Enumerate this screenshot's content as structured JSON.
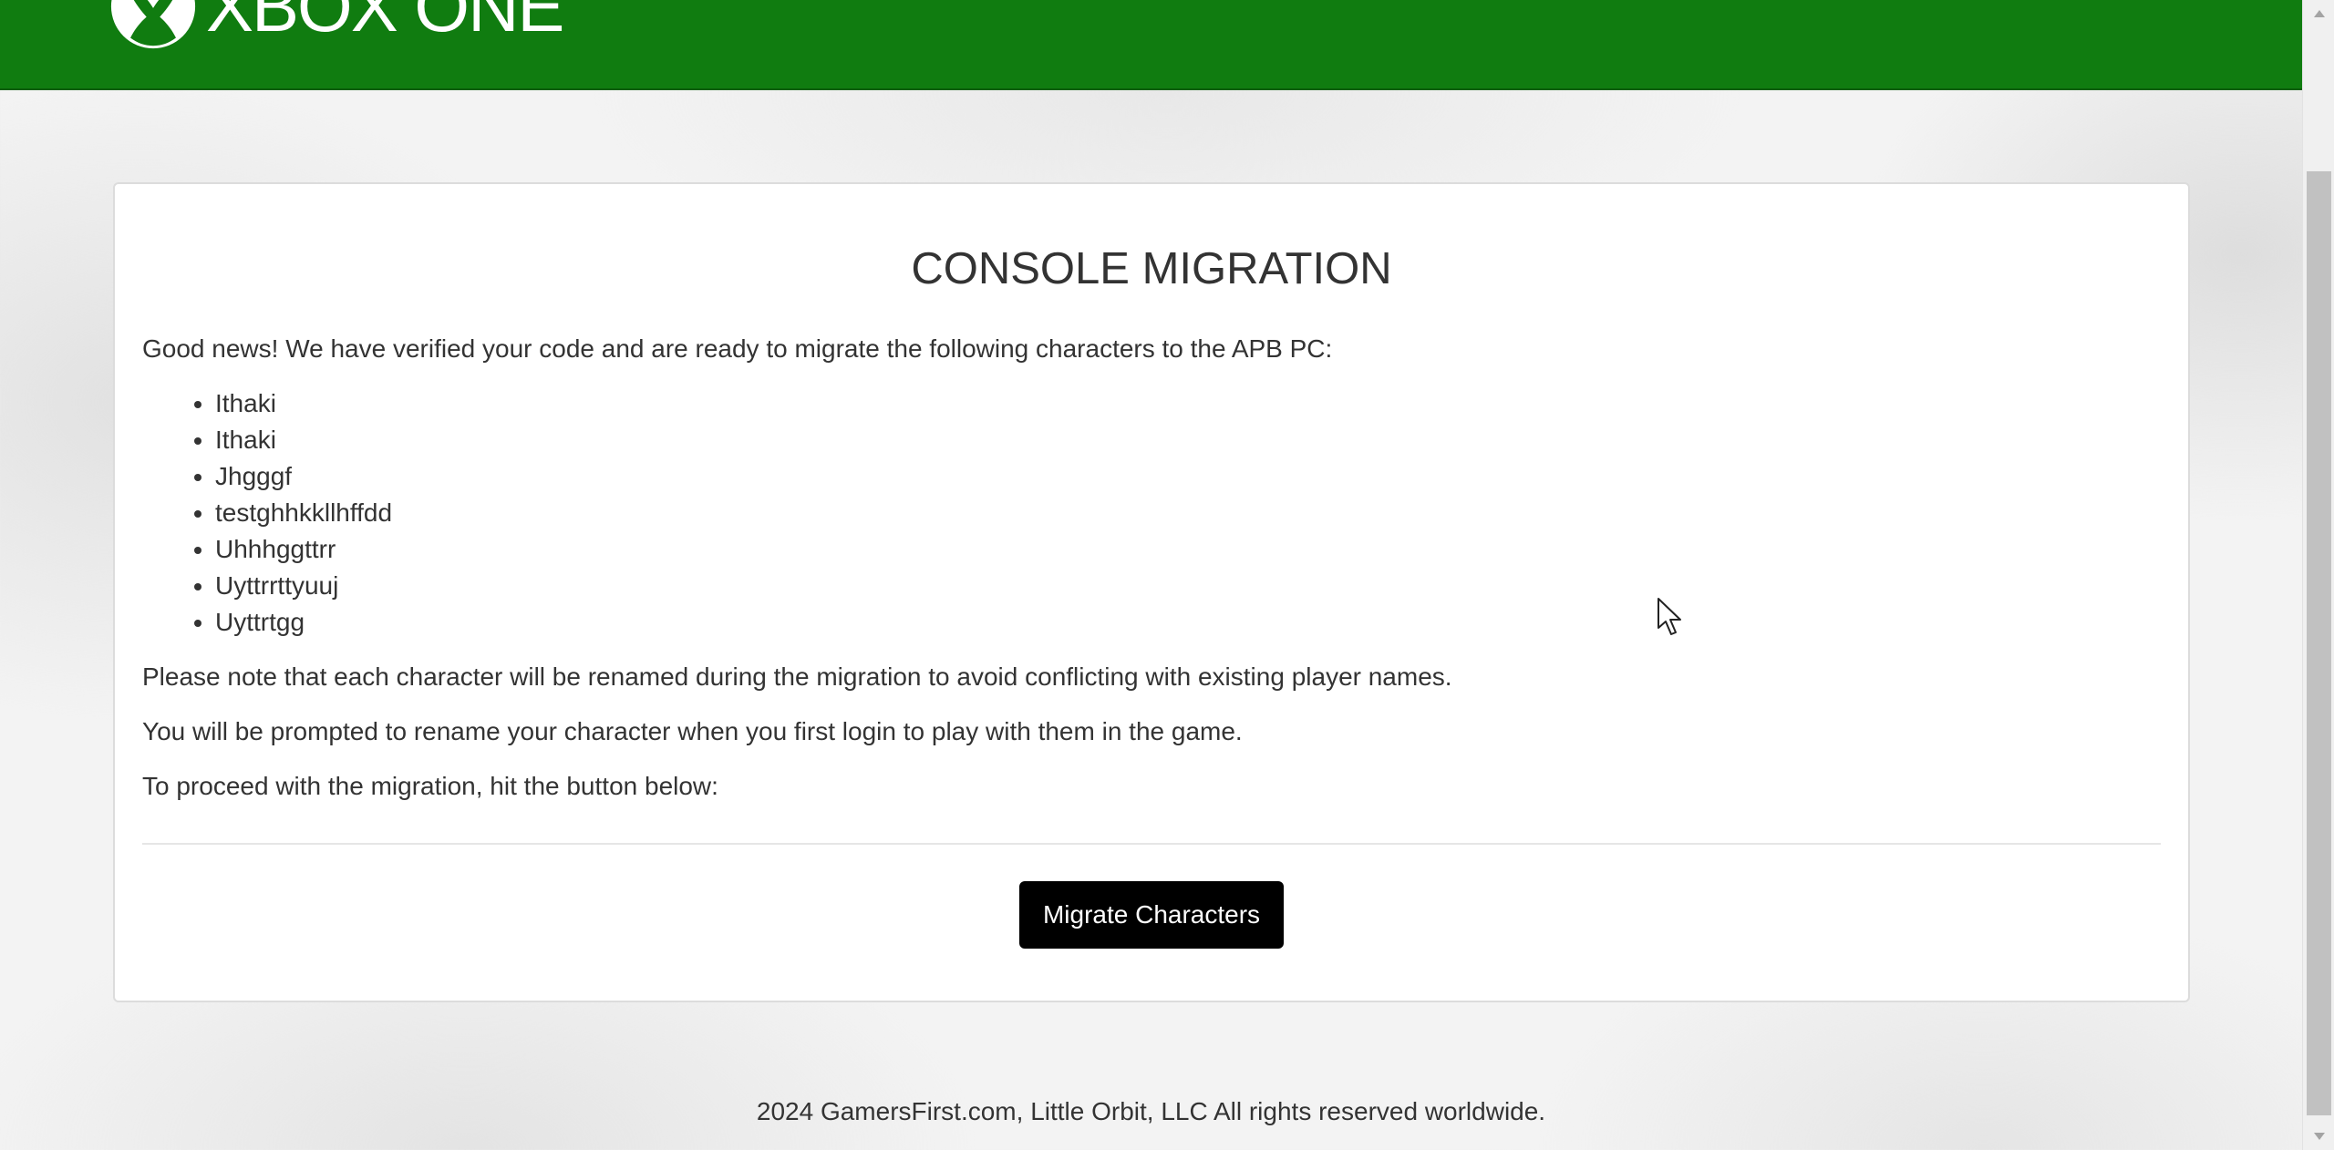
{
  "header": {
    "brand_text": "XBOX ONE",
    "logo_icon": "xbox-logo-icon",
    "background_color": "#107c10"
  },
  "main": {
    "title": "CONSOLE MIGRATION",
    "intro": "Good news! We have verified your code and are ready to migrate the following characters to the APB PC:",
    "characters": [
      "Ithaki",
      "Ithaki",
      "Jhgggf",
      "testghhkkllhffdd",
      "Uhhhggttrr",
      "Uyttrrttyuuj",
      "Uyttrtgg"
    ],
    "notes": [
      "Please note that each character will be renamed during the migration to avoid conflicting with existing player names.",
      "You will be prompted to rename your character when you first login to play with them in the game.",
      "To proceed with the migration, hit the button below:"
    ],
    "migrate_button_label": "Migrate Characters"
  },
  "footer": {
    "text": "2024 GamersFirst.com, Little Orbit, LLC All rights reserved worldwide."
  },
  "colors": {
    "accent": "#107c10",
    "button": "#000000"
  }
}
